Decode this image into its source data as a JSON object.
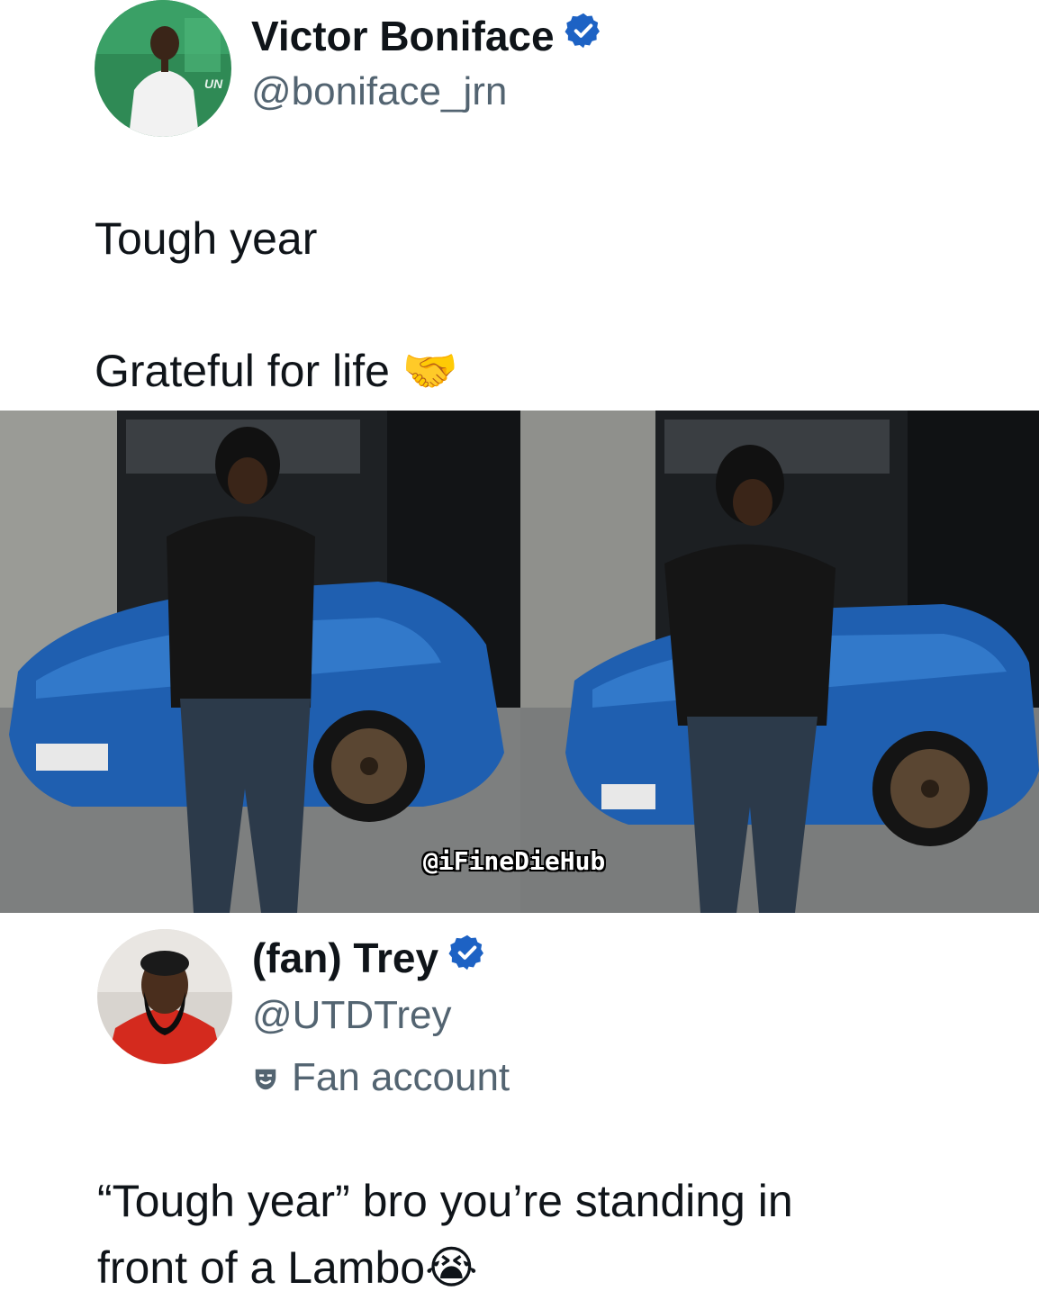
{
  "original_tweet": {
    "author_name": "Victor Boniface",
    "author_handle": "@boniface_jrn",
    "verified": true,
    "text_line_1": "Tough year",
    "text_line_2": "Grateful for life 🤝"
  },
  "media": {
    "watermark": "@iFineDieHub",
    "photo_count": 2
  },
  "reply_tweet": {
    "author_name": "(fan) Trey",
    "author_handle": "@UTDTrey",
    "verified": true,
    "badge_label": "Fan account",
    "text_line_1": "“Tough year” bro you’re standing in",
    "text_line_2": "front of a Lambo😭"
  },
  "colors": {
    "text_primary": "#0f1419",
    "text_secondary": "#536471",
    "verified_blue": "#1d62c4",
    "car_blue": "#1f5fb0"
  },
  "icons": {
    "verified": "verified-badge-icon",
    "fan_account": "theater-mask-icon"
  }
}
